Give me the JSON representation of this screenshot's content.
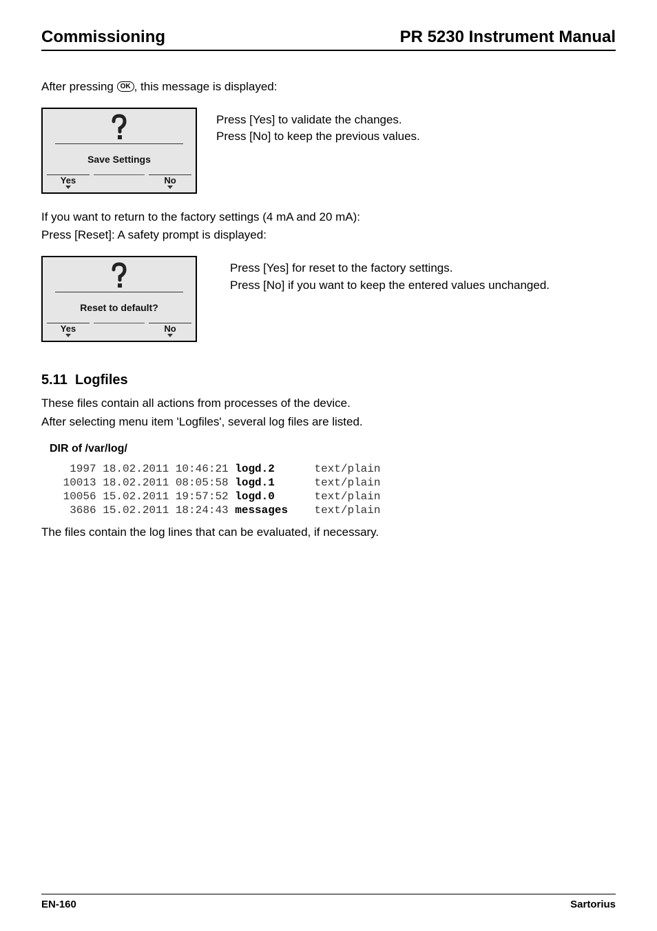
{
  "header": {
    "left": "Commissioning",
    "right": "PR 5230 Instrument Manual"
  },
  "intro": {
    "line_prefix": "After pressing ",
    "ok_label": "OK",
    "line_suffix": ", this message is displayed:"
  },
  "dialog1": {
    "title": "Save Settings",
    "yes": "Yes",
    "no": "No",
    "side": [
      "Press [Yes] to validate the changes.",
      "Press [No] to keep the previous values."
    ]
  },
  "mid": {
    "line1": "If you want to return to the factory settings (4 mA and 20 mA):",
    "line2": "Press [Reset]: A safety prompt is displayed:"
  },
  "dialog2": {
    "title": "Reset to default?",
    "yes": "Yes",
    "no": "No",
    "side": [
      "Press [Yes] for reset to the factory settings.",
      "Press [No] if you want to keep the entered values unchanged."
    ]
  },
  "section": {
    "number": "5.11",
    "title": "Logfiles",
    "p1": "These files contain all actions from processes of the device.",
    "p2": "After selecting menu item 'Logfiles', several log files are listed.",
    "dir_label": "DIR of /var/log/",
    "files": [
      {
        "size": "1997",
        "date": "18.02.2011",
        "time": "10:46:21",
        "name": "logd.2",
        "mime": "text/plain"
      },
      {
        "size": "10013",
        "date": "18.02.2011",
        "time": "08:05:58",
        "name": "logd.1",
        "mime": "text/plain"
      },
      {
        "size": "10056",
        "date": "15.02.2011",
        "time": "19:57:52",
        "name": "logd.0",
        "mime": "text/plain"
      },
      {
        "size": "3686",
        "date": "15.02.2011",
        "time": "18:24:43",
        "name": "messages",
        "mime": "text/plain"
      }
    ],
    "p3": "The files contain the log lines that can be evaluated, if necessary."
  },
  "footer": {
    "left": "EN-160",
    "right": "Sartorius"
  }
}
